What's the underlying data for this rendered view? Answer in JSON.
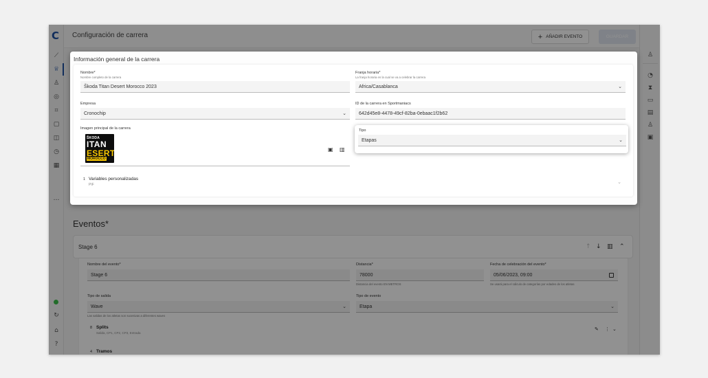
{
  "rail": {
    "logo": "C",
    "icons": [
      "chart-line-icon",
      "trophy-icon",
      "user-icon",
      "shield-check-icon",
      "qr-scan-icon",
      "document-icon",
      "database-icon",
      "clock-icon",
      "grid-icon",
      "more-icon",
      "status-online-icon",
      "sync-icon",
      "home-icon",
      "help-icon"
    ]
  },
  "right_rail": {
    "icons": [
      "user-group-icon",
      "stopwatch-icon",
      "hourglass-icon",
      "monitor-icon",
      "receipt-icon",
      "people-icon",
      "chip-icon"
    ]
  },
  "header": {
    "title": "Configuración de carrera",
    "add_event": "AÑADIR EVENTO",
    "save": "GUARDAR"
  },
  "modal": {
    "title": "Información general de la carrera",
    "name": {
      "label": "Nombre*",
      "help": "Nombre completo de la carrera",
      "value": "Škoda Titan Desert Morocco 2023"
    },
    "timezone": {
      "label": "Franja horaria*",
      "help": "La franja horaria en la cual se va a celebrar la carrera",
      "value": "Africa/Casablanca"
    },
    "company": {
      "label": "Empresa",
      "value": "Cronochip"
    },
    "sportmaniacs_id": {
      "label": "ID de la carrera en Sportmaniacs",
      "value": "642d45e8-4478-49cf-82ba-0ebaac1f2b62"
    },
    "image": {
      "label": "Imagen principal de la carrera",
      "logo_lines": [
        "ŠKODA",
        "ITAN",
        "ESERT",
        "MOROCCO"
      ]
    },
    "type": {
      "label": "Tipo",
      "value": "Etapas"
    },
    "custom_vars": {
      "count": "1",
      "label": "Variables personalizadas",
      "sub": "PIF"
    }
  },
  "events": {
    "title": "Eventos*",
    "stage": {
      "title": "Stage 6",
      "event_name": {
        "label": "Nombre del evento*",
        "value": "Stage 6"
      },
      "distance": {
        "label": "Distancia*",
        "value": "78000",
        "help": "Distancia del evento EN METROS"
      },
      "date": {
        "label": "Fecha de celebración del evento*",
        "value": "05/06/2023, 09:00",
        "help": "Se usará para el cálculo de categorías por edades de los atletas"
      },
      "start_type": {
        "label": "Tipo de salida",
        "value": "Wave",
        "help": "Las salidas de los atletas son sucesivas a diferentes waves"
      },
      "event_type": {
        "label": "Tipo de evento",
        "value": "Etapa"
      },
      "splits": {
        "count": "8",
        "label": "Splits",
        "help": "Salida, CP1, CP2, CP3, Entrada"
      },
      "tramos": {
        "count": "4",
        "label": "Tramos"
      }
    }
  }
}
